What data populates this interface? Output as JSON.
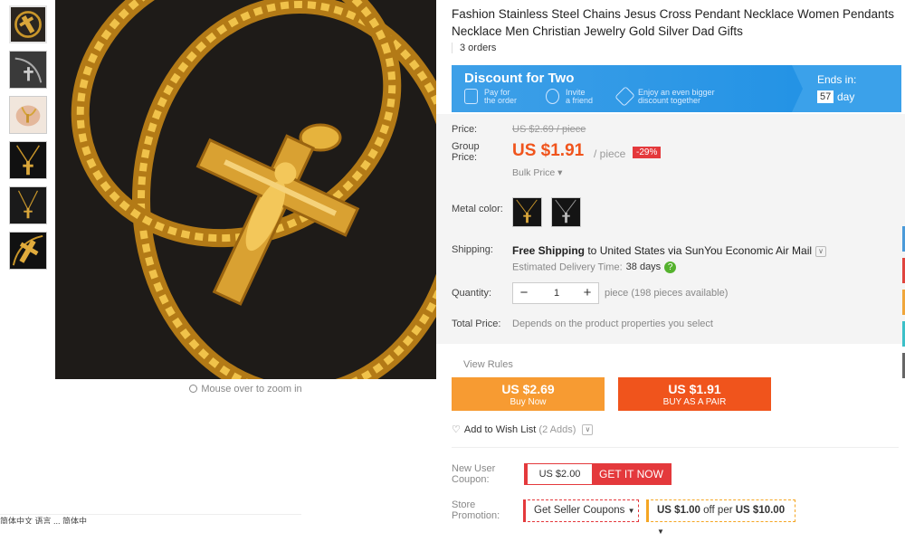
{
  "gallery": {
    "thumbs": [
      "thumb-1",
      "thumb-2",
      "thumb-3",
      "thumb-4",
      "thumb-5",
      "thumb-6"
    ],
    "zoom_hint": "Mouse over to zoom in",
    "bottom_fragment": "简体中文 语言  ...  简体中"
  },
  "product": {
    "title": "Fashion Stainless Steel Chains Jesus Cross Pendant Necklace Women Pendants Necklace Men Christian Jewelry Gold Silver Dad Gifts",
    "orders": "3 orders"
  },
  "banner": {
    "title": "Discount for Two",
    "feature1": [
      "Pay for",
      "the order"
    ],
    "feature2": [
      "Invite",
      "a friend"
    ],
    "feature3": [
      "Enjoy an even bigger",
      "discount together"
    ],
    "ends_label": "Ends in:",
    "ends_days": "57",
    "ends_unit": "day"
  },
  "pricing": {
    "price_label": "Price:",
    "original": "US $2.69 / piece",
    "group_label": [
      "Group",
      "Price:"
    ],
    "group_price": "US $1.91",
    "per": "/ piece",
    "discount": "-29%",
    "bulk": "Bulk Price ▾"
  },
  "metal": {
    "label": "Metal color:",
    "options": [
      "gold",
      "silver"
    ]
  },
  "shipping": {
    "label": "Shipping:",
    "free": "Free Shipping",
    "to": " to United States via SunYou Economic Air Mail",
    "est_label": "Estimated Delivery Time:",
    "est_value": "38 days"
  },
  "quantity": {
    "label": "Quantity:",
    "value": "1",
    "available": "piece (198 pieces available)"
  },
  "total": {
    "label": "Total Price:",
    "value": "Depends on the product properties you select"
  },
  "actions": {
    "view_rules": "View Rules",
    "buy_price": "US $2.69",
    "buy_label": "Buy Now",
    "pair_price": "US $1.91",
    "pair_label": "BUY AS A PAIR",
    "wish": "Add to Wish List",
    "wish_count": "(2 Adds)"
  },
  "coupons": {
    "new_user_label": [
      "New User",
      "Coupon:"
    ],
    "new_user_amount": "US $2.00",
    "get_it": "GET IT NOW",
    "store_label": [
      "Store",
      "Promotion:"
    ],
    "seller_coupons": "Get Seller Coupons",
    "promo_a": "US $1.00",
    "promo_mid": " off per ",
    "promo_b": "US $10.00"
  },
  "colors": {
    "accent": "#f0541c",
    "buy_now": "#f79b32",
    "banner": "#1c8fe4",
    "coupon_red": "#e4393c"
  }
}
